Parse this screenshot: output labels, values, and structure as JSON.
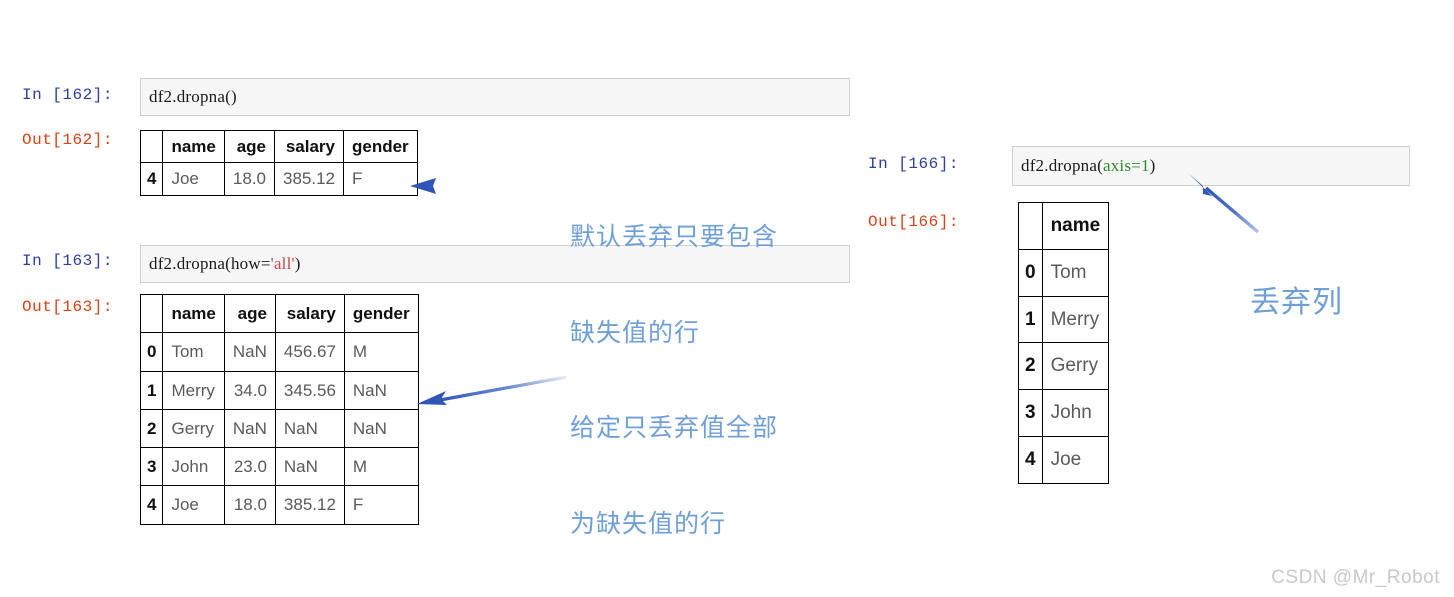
{
  "watermark": "CSDN @Mr_Robot",
  "cells": [
    {
      "name": "cell-162",
      "in_prompt": "In  [162]:",
      "out_prompt": "Out[162]:",
      "code_prefix": "df2.dropna(",
      "code_arg": "",
      "code_suffix": ")"
    },
    {
      "name": "cell-163",
      "in_prompt": "In  [163]:",
      "out_prompt": "Out[163]:",
      "code_prefix": "df2.dropna(how=",
      "code_arg": "'all'",
      "code_suffix": ")"
    },
    {
      "name": "cell-166",
      "in_prompt": "In  [166]:",
      "out_prompt": "Out[166]:",
      "code_prefix": "df2.dropna(",
      "code_arg": "axis=1",
      "code_suffix": ")"
    }
  ],
  "table_162": {
    "columns": [
      "",
      "name",
      "age",
      "salary",
      "gender"
    ],
    "rows": [
      {
        "index": "4",
        "name": "Joe",
        "age": "18.0",
        "salary": "385.12",
        "gender": "F"
      }
    ]
  },
  "table_163": {
    "columns": [
      "",
      "name",
      "age",
      "salary",
      "gender"
    ],
    "rows": [
      {
        "index": "0",
        "name": "Tom",
        "age": "NaN",
        "salary": "456.67",
        "gender": "M"
      },
      {
        "index": "1",
        "name": "Merry",
        "age": "34.0",
        "salary": "345.56",
        "gender": "NaN"
      },
      {
        "index": "2",
        "name": "Gerry",
        "age": "NaN",
        "salary": "NaN",
        "gender": "NaN"
      },
      {
        "index": "3",
        "name": "John",
        "age": "23.0",
        "salary": "NaN",
        "gender": "M"
      },
      {
        "index": "4",
        "name": "Joe",
        "age": "18.0",
        "salary": "385.12",
        "gender": "F"
      }
    ]
  },
  "table_166": {
    "columns": [
      "",
      "name"
    ],
    "rows": [
      {
        "index": "0",
        "name": "Tom"
      },
      {
        "index": "1",
        "name": "Merry"
      },
      {
        "index": "2",
        "name": "Gerry"
      },
      {
        "index": "3",
        "name": "John"
      },
      {
        "index": "4",
        "name": "Joe"
      }
    ]
  },
  "annotations": [
    {
      "name": "annotation-default-drop-rows",
      "line1": "默认丢弃只要包含",
      "line2": "缺失值的行"
    },
    {
      "name": "annotation-how-all",
      "line1": "给定只丢弃值全部",
      "line2": "为缺失值的行"
    },
    {
      "name": "annotation-drop-columns",
      "line1": "丢弃列",
      "line2": ""
    }
  ],
  "colors": {
    "in_prompt": "#303f9f",
    "out_prompt": "#d84315",
    "annotation": "#6f9fd8",
    "arrow": "#3b63c4",
    "code_bg": "#f7f7f7",
    "string_literal": "#c94a4a",
    "keyword_arg": "#2e8b2e"
  }
}
